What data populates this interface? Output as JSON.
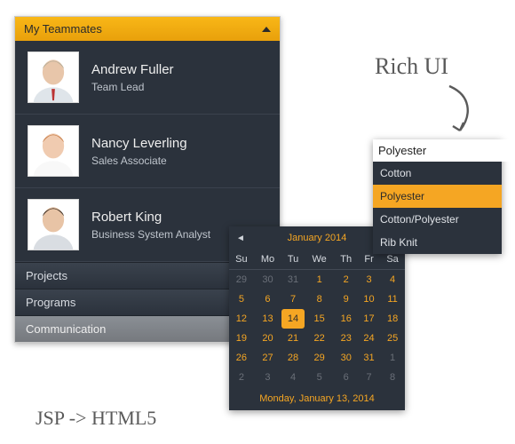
{
  "panel": {
    "title": "My Teammates",
    "teammates": [
      {
        "name": "Andrew Fuller",
        "role": "Team Lead"
      },
      {
        "name": "Nancy Leverling",
        "role": "Sales Associate"
      },
      {
        "name": "Robert King",
        "role": "Business System Analyst"
      }
    ],
    "sections": [
      "Projects",
      "Programs",
      "Communication"
    ]
  },
  "calendar": {
    "month_label": "January 2014",
    "footer": "Monday, January 13, 2014",
    "dow": [
      "Su",
      "Mo",
      "Tu",
      "We",
      "Th",
      "Fr",
      "Sa"
    ],
    "weeks": [
      [
        {
          "d": 29,
          "off": true
        },
        {
          "d": 30,
          "off": true
        },
        {
          "d": 31,
          "off": true
        },
        {
          "d": 1
        },
        {
          "d": 2
        },
        {
          "d": 3
        },
        {
          "d": 4
        }
      ],
      [
        {
          "d": 5
        },
        {
          "d": 6
        },
        {
          "d": 7
        },
        {
          "d": 8
        },
        {
          "d": 9
        },
        {
          "d": 10
        },
        {
          "d": 11
        }
      ],
      [
        {
          "d": 12
        },
        {
          "d": 13
        },
        {
          "d": 14,
          "today": true
        },
        {
          "d": 15
        },
        {
          "d": 16
        },
        {
          "d": 17
        },
        {
          "d": 18
        }
      ],
      [
        {
          "d": 19
        },
        {
          "d": 20
        },
        {
          "d": 21
        },
        {
          "d": 22
        },
        {
          "d": 23
        },
        {
          "d": 24
        },
        {
          "d": 25
        }
      ],
      [
        {
          "d": 26
        },
        {
          "d": 27
        },
        {
          "d": 28
        },
        {
          "d": 29
        },
        {
          "d": 30
        },
        {
          "d": 31
        },
        {
          "d": 1,
          "off": true
        }
      ],
      [
        {
          "d": 2,
          "off": true
        },
        {
          "d": 3,
          "off": true
        },
        {
          "d": 4,
          "off": true
        },
        {
          "d": 5,
          "off": true
        },
        {
          "d": 6,
          "off": true
        },
        {
          "d": 7,
          "off": true
        },
        {
          "d": 8,
          "off": true
        }
      ]
    ]
  },
  "combo": {
    "value": "Polyester",
    "options": [
      "Cotton",
      "Polyester",
      "Cotton/Polyester",
      "Rib Knit"
    ],
    "selected_index": 1
  },
  "annotations": {
    "rich_ui": "Rich UI",
    "jsp": "JSP -> HTML5"
  },
  "colors": {
    "accent": "#f5a623",
    "panel": "#2b323c"
  }
}
